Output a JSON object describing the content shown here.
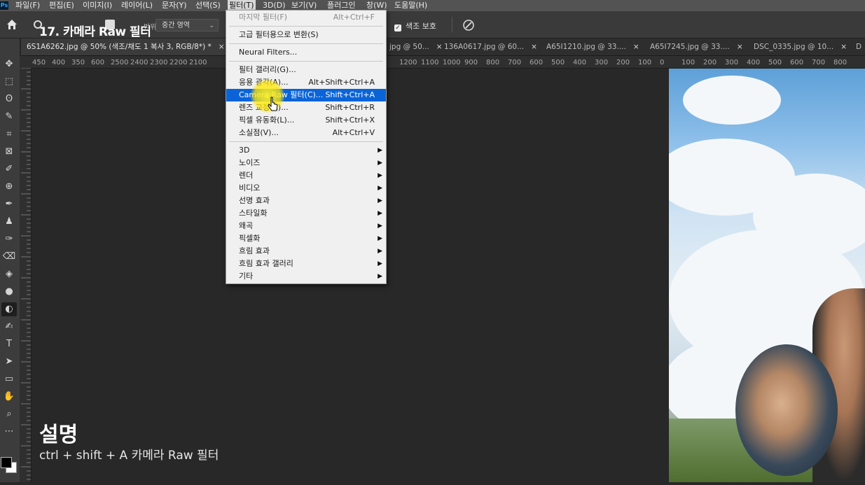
{
  "menubar": {
    "items": [
      "파일(F)",
      "편집(E)",
      "이미지(I)",
      "레이어(L)",
      "문자(Y)",
      "선택(S)",
      "필터(T)",
      "3D(D)",
      "보기(V)",
      "플러그인",
      "창(W)",
      "도움말(H)"
    ],
    "active_index": 6
  },
  "options_bar": {
    "overlay_title": "17. 카메라 Raw 필터",
    "range_label": "범위:",
    "range_value": "중간 영역",
    "protect_label": "색조 보호",
    "protect_checked": true
  },
  "tabs": [
    {
      "label": "6S1A6262.jpg @ 50% (색조/채도 1 복사 3, RGB/8*) *",
      "active": true
    },
    {
      "label": "jpg @ 50...",
      "active": false
    },
    {
      "label": "136A0617.jpg @ 60...",
      "active": false
    },
    {
      "label": "A65I1210.jpg @ 33....",
      "active": false
    },
    {
      "label": "A65I7245.jpg @ 33....",
      "active": false
    },
    {
      "label": "DSC_0335.jpg @ 10...",
      "active": false
    },
    {
      "label": "D",
      "active": false
    }
  ],
  "ruler": {
    "left_ticks": [
      "450",
      "400",
      "350",
      "600",
      "2500",
      "2400",
      "2300",
      "2200",
      "2100"
    ],
    "right_ticks": [
      "1200",
      "1100",
      "1000",
      "900",
      "800",
      "700",
      "600",
      "500",
      "400",
      "300",
      "200",
      "100",
      "0",
      "100",
      "200",
      "300",
      "400",
      "500",
      "600",
      "700",
      "800"
    ]
  },
  "filter_menu": {
    "items": [
      {
        "label": "마지막 필터(F)",
        "shortcut": "Alt+Ctrl+F",
        "disabled": true
      },
      {
        "sep": true
      },
      {
        "label": "고급 필터용으로 변환(S)",
        "shortcut": ""
      },
      {
        "sep": true
      },
      {
        "label": "Neural Filters...",
        "shortcut": ""
      },
      {
        "sep": true
      },
      {
        "label": "필터 갤러리(G)...",
        "shortcut": ""
      },
      {
        "label": "응용 광각(A)...",
        "shortcut": "Alt+Shift+Ctrl+A"
      },
      {
        "label": "Camera Raw 필터(C)...",
        "shortcut": "Shift+Ctrl+A",
        "highlighted": true
      },
      {
        "label": "렌즈 교정(R)...",
        "shortcut": "Shift+Ctrl+R"
      },
      {
        "label": "픽셀 유동화(L)...",
        "shortcut": "Shift+Ctrl+X"
      },
      {
        "label": "소실점(V)...",
        "shortcut": "Alt+Ctrl+V"
      },
      {
        "sep": true
      },
      {
        "label": "3D",
        "submenu": true
      },
      {
        "label": "노이즈",
        "submenu": true
      },
      {
        "label": "렌더",
        "submenu": true
      },
      {
        "label": "비디오",
        "submenu": true
      },
      {
        "label": "선명 효과",
        "submenu": true
      },
      {
        "label": "스타일화",
        "submenu": true
      },
      {
        "label": "왜곡",
        "submenu": true
      },
      {
        "label": "픽셀화",
        "submenu": true
      },
      {
        "label": "흐림 효과",
        "submenu": true
      },
      {
        "label": "흐림 효과 갤러리",
        "submenu": true
      },
      {
        "label": "기타",
        "submenu": true
      }
    ]
  },
  "caption": {
    "title": "설명",
    "subtitle": "ctrl + shift + A 카메라 Raw 필터"
  },
  "toolbar": {
    "tools": [
      "move-tool",
      "marquee-tool",
      "lasso-tool",
      "quick-select-tool",
      "crop-tool",
      "frame-tool",
      "eyedropper-tool",
      "healing-tool",
      "brush-tool",
      "stamp-tool",
      "history-brush-tool",
      "eraser-tool",
      "paint-bucket-tool",
      "blur-tool",
      "dodge-tool",
      "pen-tool",
      "type-tool",
      "path-select-tool",
      "rectangle-tool",
      "hand-tool",
      "zoom-tool",
      "more-tools"
    ]
  },
  "colors": {
    "menu_highlight": "#0a64d8",
    "ui_dark": "#282828"
  }
}
